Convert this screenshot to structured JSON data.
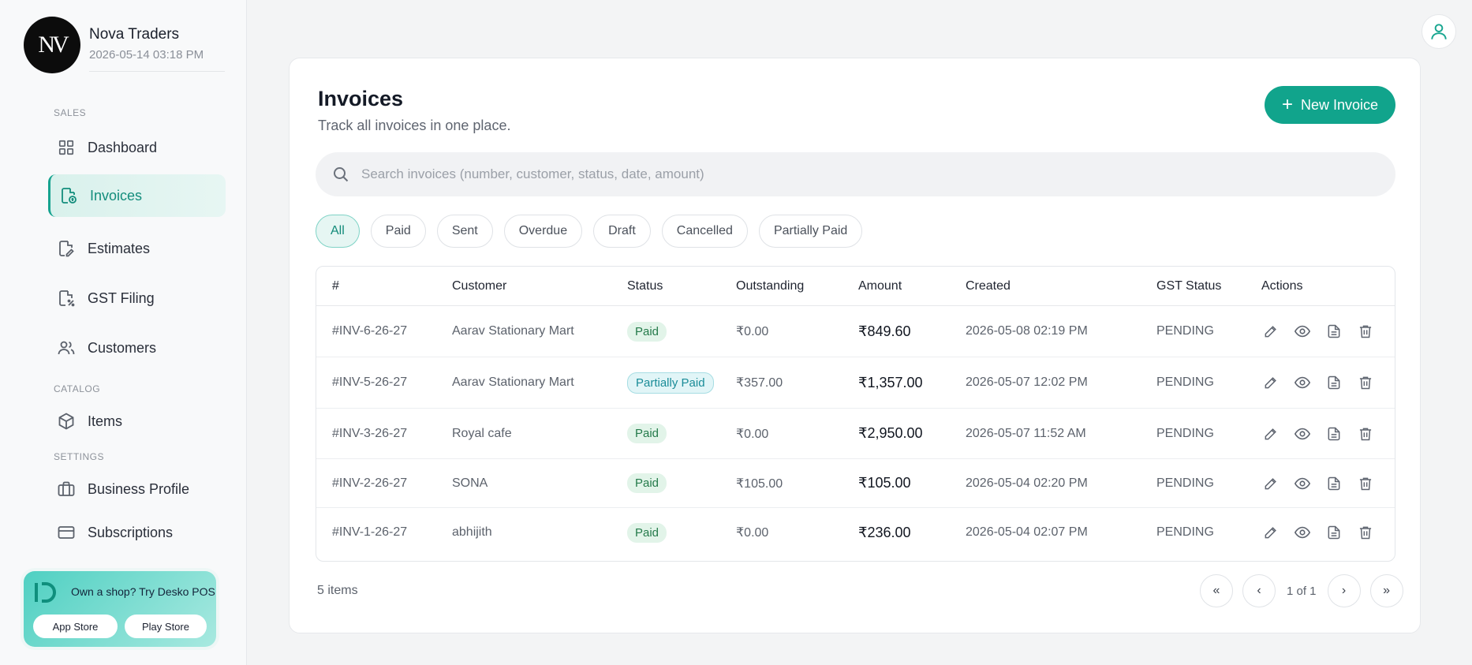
{
  "business": {
    "logo_text": "NV",
    "name": "Nova Traders",
    "datetime": "2026-05-14 03:18 PM"
  },
  "sidebar": {
    "sections": {
      "sales": "SALES",
      "catalog": "CATALOG",
      "settings": "SETTINGS"
    },
    "items": [
      {
        "label": "Dashboard",
        "icon": "grid-icon"
      },
      {
        "label": "Invoices",
        "icon": "invoice-icon",
        "active": true
      },
      {
        "label": "Estimates",
        "icon": "estimate-icon"
      },
      {
        "label": "GST Filing",
        "icon": "percent-doc-icon"
      },
      {
        "label": "Customers",
        "icon": "users-icon"
      },
      {
        "label": "Items",
        "icon": "cube-icon"
      },
      {
        "label": "Business Profile",
        "icon": "briefcase-icon"
      },
      {
        "label": "Subscriptions",
        "icon": "card-icon"
      }
    ],
    "promo": {
      "text": "Own a shop? Try Desko POS",
      "app_store": "App Store",
      "play_store": "Play Store"
    }
  },
  "main": {
    "title": "Invoices",
    "subtitle": "Track all invoices in one place.",
    "new_button": "New Invoice",
    "search_placeholder": "Search invoices (number, customer, status, date, amount)",
    "filters": [
      "All",
      "Paid",
      "Sent",
      "Overdue",
      "Draft",
      "Cancelled",
      "Partially Paid"
    ],
    "active_filter": "All",
    "columns": [
      "#",
      "Customer",
      "Status",
      "Outstanding",
      "Amount",
      "Created",
      "GST Status",
      "Actions"
    ],
    "rows": [
      {
        "number": "#INV-6-26-27",
        "customer": "Aarav Stationary Mart",
        "status": "Paid",
        "outstanding": "₹0.00",
        "amount": "₹849.60",
        "created": "2026-05-08 02:19 PM",
        "gst_status": "PENDING"
      },
      {
        "number": "#INV-5-26-27",
        "customer": "Aarav Stationary Mart",
        "status": "Partially Paid",
        "outstanding": "₹357.00",
        "amount": "₹1,357.00",
        "created": "2026-05-07 12:02 PM",
        "gst_status": "PENDING"
      },
      {
        "number": "#INV-3-26-27",
        "customer": "Royal cafe",
        "status": "Paid",
        "outstanding": "₹0.00",
        "amount": "₹2,950.00",
        "created": "2026-05-07 11:52 AM",
        "gst_status": "PENDING"
      },
      {
        "number": "#INV-2-26-27",
        "customer": "SONA",
        "status": "Paid",
        "outstanding": "₹105.00",
        "amount": "₹105.00",
        "created": "2026-05-04 02:20 PM",
        "gst_status": "PENDING"
      },
      {
        "number": "#INV-1-26-27",
        "customer": "abhijith",
        "status": "Paid",
        "outstanding": "₹0.00",
        "amount": "₹236.00",
        "created": "2026-05-04 02:07 PM",
        "gst_status": "PENDING"
      }
    ],
    "items_count": "5 items",
    "pagination": {
      "first": "«",
      "prev": "‹",
      "info": "1 of 1",
      "next": "›",
      "last": "»"
    }
  },
  "colors": {
    "accent": "#11a48c",
    "paid_bg": "#e2f4e9",
    "partial_bg": "#e1f5f7"
  }
}
